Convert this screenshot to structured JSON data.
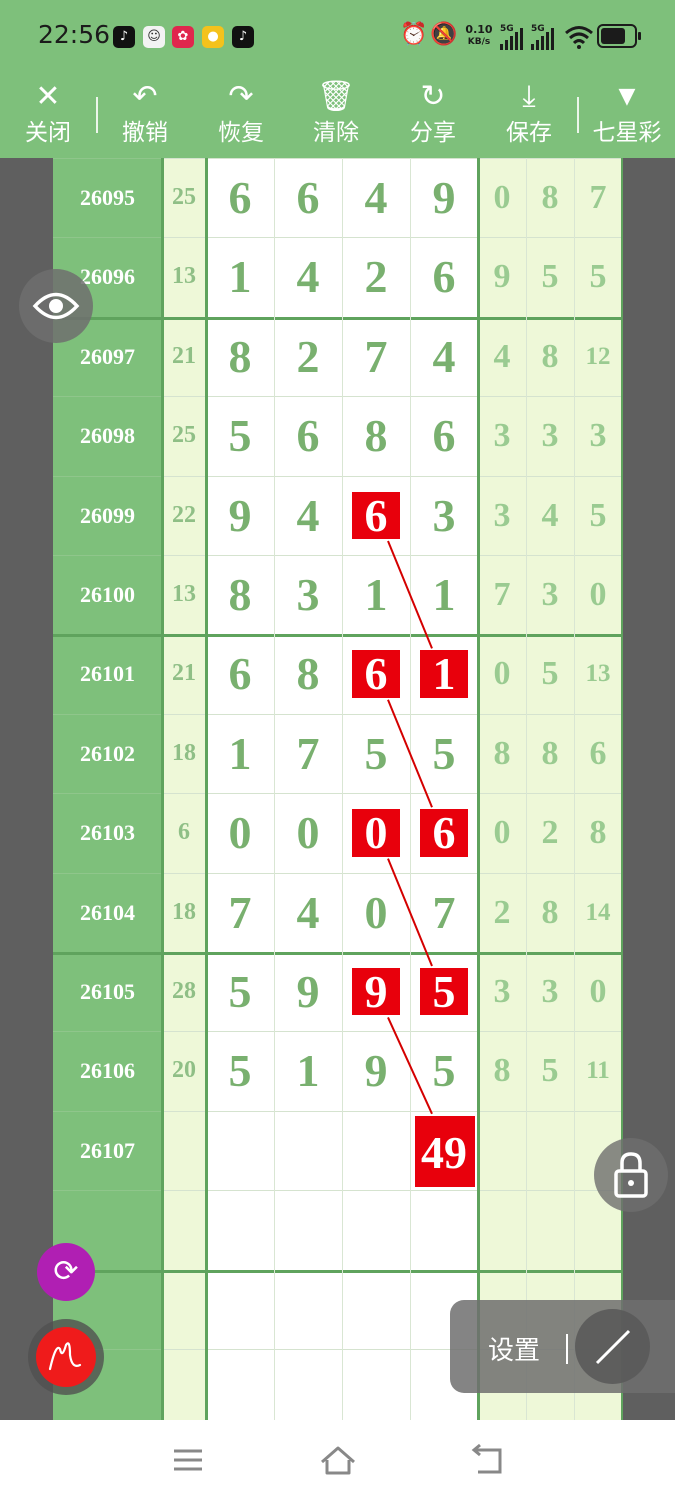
{
  "status_bar": {
    "time": "22:56",
    "net_speed_value": "0.10",
    "net_speed_unit": "KB/s",
    "signal_1_label": "5G",
    "signal_2_label": "5G"
  },
  "toolbar": {
    "close_label": "关闭",
    "undo_label": "撤销",
    "redo_label": "恢复",
    "clear_label": "清除",
    "share_label": "分享",
    "save_label": "保存",
    "lottery_label": "七星彩"
  },
  "chart_data": {
    "type": "table",
    "columns": [
      "issue",
      "sum",
      "d1",
      "d2",
      "d3",
      "d4",
      "s1",
      "s2",
      "s3"
    ],
    "rows": [
      {
        "issue": "26095",
        "sum": "25",
        "digits": [
          "6",
          "6",
          "4",
          "9"
        ],
        "sub": [
          "0",
          "8",
          "7"
        ]
      },
      {
        "issue": "26096",
        "sum": "13",
        "digits": [
          "1",
          "4",
          "2",
          "6"
        ],
        "sub": [
          "9",
          "5",
          "5"
        ]
      },
      {
        "issue": "26097",
        "sum": "21",
        "digits": [
          "8",
          "2",
          "7",
          "4"
        ],
        "sub": [
          "4",
          "8",
          "12"
        ]
      },
      {
        "issue": "26098",
        "sum": "25",
        "digits": [
          "5",
          "6",
          "8",
          "6"
        ],
        "sub": [
          "3",
          "3",
          "3"
        ]
      },
      {
        "issue": "26099",
        "sum": "22",
        "digits": [
          "9",
          "4",
          "6",
          "3"
        ],
        "sub": [
          "3",
          "4",
          "5"
        ]
      },
      {
        "issue": "26100",
        "sum": "13",
        "digits": [
          "8",
          "3",
          "1",
          "1"
        ],
        "sub": [
          "7",
          "3",
          "0"
        ]
      },
      {
        "issue": "26101",
        "sum": "21",
        "digits": [
          "6",
          "8",
          "6",
          "1"
        ],
        "sub": [
          "0",
          "5",
          "13"
        ]
      },
      {
        "issue": "26102",
        "sum": "18",
        "digits": [
          "1",
          "7",
          "5",
          "5"
        ],
        "sub": [
          "8",
          "8",
          "6"
        ]
      },
      {
        "issue": "26103",
        "sum": "6",
        "digits": [
          "0",
          "0",
          "0",
          "6"
        ],
        "sub": [
          "0",
          "2",
          "8"
        ]
      },
      {
        "issue": "26104",
        "sum": "18",
        "digits": [
          "7",
          "4",
          "0",
          "7"
        ],
        "sub": [
          "2",
          "8",
          "14"
        ]
      },
      {
        "issue": "26105",
        "sum": "28",
        "digits": [
          "5",
          "9",
          "9",
          "5"
        ],
        "sub": [
          "3",
          "3",
          "0"
        ]
      },
      {
        "issue": "26106",
        "sum": "20",
        "digits": [
          "5",
          "1",
          "9",
          "5"
        ],
        "sub": [
          "8",
          "5",
          "11"
        ]
      },
      {
        "issue": "26107",
        "sum": "",
        "digits": [
          "",
          "",
          "",
          ""
        ],
        "sub": [
          "",
          "",
          ""
        ]
      }
    ],
    "highlights": [
      {
        "row": 4,
        "col": 2
      },
      {
        "row": 6,
        "col": 2
      },
      {
        "row": 6,
        "col": 3
      },
      {
        "row": 8,
        "col": 2
      },
      {
        "row": 8,
        "col": 3
      },
      {
        "row": 10,
        "col": 2
      },
      {
        "row": 10,
        "col": 3
      }
    ],
    "prediction": {
      "row": 12,
      "col": 3,
      "value": "49"
    },
    "connect_lines": [
      [
        [
          4,
          2
        ],
        [
          6,
          3
        ]
      ],
      [
        [
          6,
          2
        ],
        [
          8,
          3
        ]
      ],
      [
        [
          8,
          2
        ],
        [
          10,
          3
        ]
      ],
      [
        [
          10,
          2
        ],
        [
          12,
          3
        ]
      ]
    ],
    "group_size": 4,
    "colors": {
      "header_green": "#7ec07b",
      "issue_column": "#7ec07b",
      "highlight_red": "#e8000c",
      "connector_red": "#d40000",
      "digit_green": "#79b06f",
      "pale_column": "#eef8d8"
    }
  },
  "widgets": {
    "eye_icon": "eye-icon",
    "lock_icon": "lock-icon",
    "refresh_icon": "refresh-icon",
    "pen_icon": "pen-icon",
    "settings_label": "设置",
    "line_icon": "line-tool-icon"
  }
}
